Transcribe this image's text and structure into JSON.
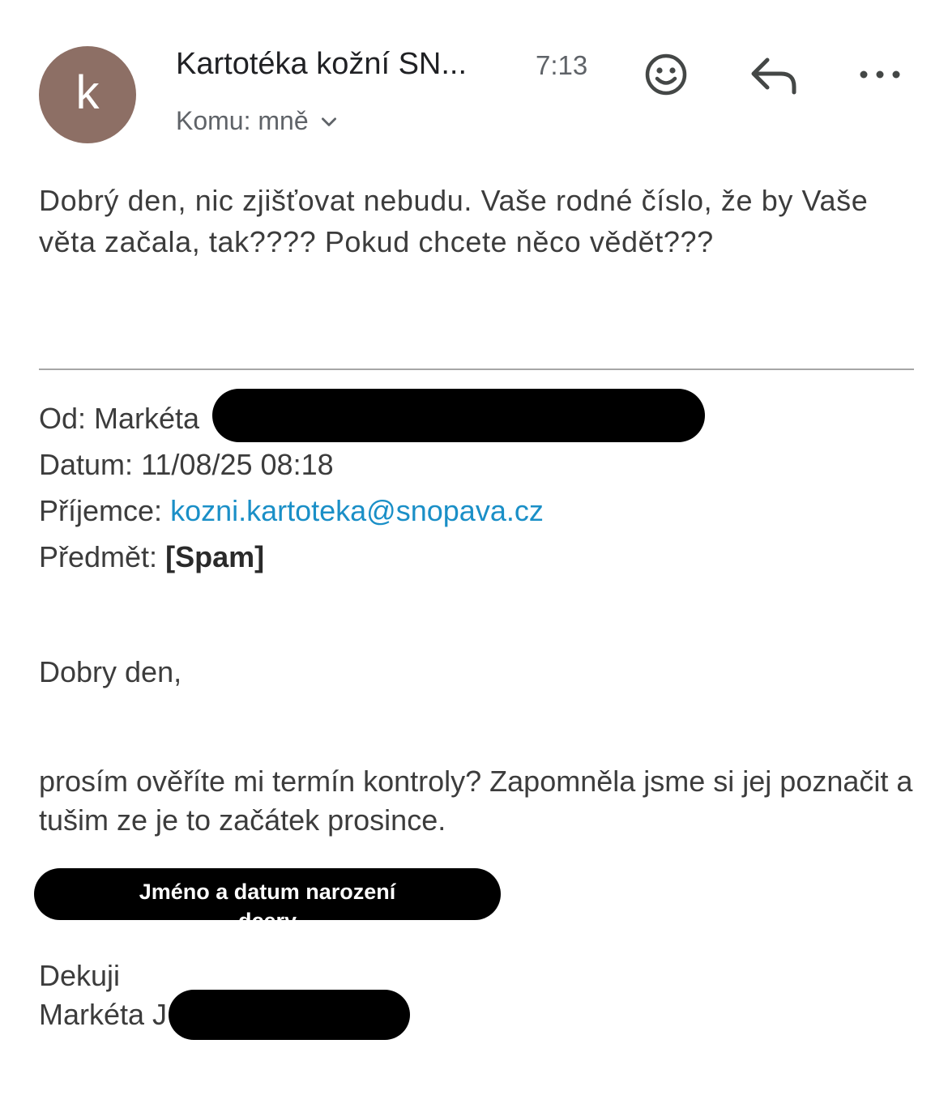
{
  "header": {
    "avatar_letter": "k",
    "sender_name": "Kartotéka kožní SN...",
    "time": "7:13",
    "recipient_label": "Komu: mně",
    "icons": [
      "emoji-icon",
      "reply-icon",
      "more-icon",
      "chevron-down-icon"
    ]
  },
  "reply_body": {
    "text": "Dobrý den, nic zjišťovat nebudu. Vaše rodné číslo, že by Vaše věta začala,  tak???? Pokud chcete něco vědět???"
  },
  "quoted": {
    "from_label": "Od: Markéta",
    "date_label": "Datum:",
    "date_value": "11/08/25 08:18",
    "to_label": "Příjemce:",
    "to_value": "kozni.kartoteka@snopava.cz",
    "subject_label": "Předmět:",
    "subject_value": "[Spam]",
    "greeting": "Dobry den,",
    "paragraph": "prosím ověříte mi termín kontroly? Zapomněla jsme si jej poznačit a tušim ze je to začátek prosince.",
    "redaction_note": "Jméno a datum narození dcery",
    "thanks": "Dekuji",
    "signature": "Markéta J"
  },
  "colors": {
    "avatar": "#8d6f65",
    "link": "#1a8fc7",
    "text": "#3c3c3c",
    "divider": "#a6a6a6",
    "redaction": "#000000"
  }
}
